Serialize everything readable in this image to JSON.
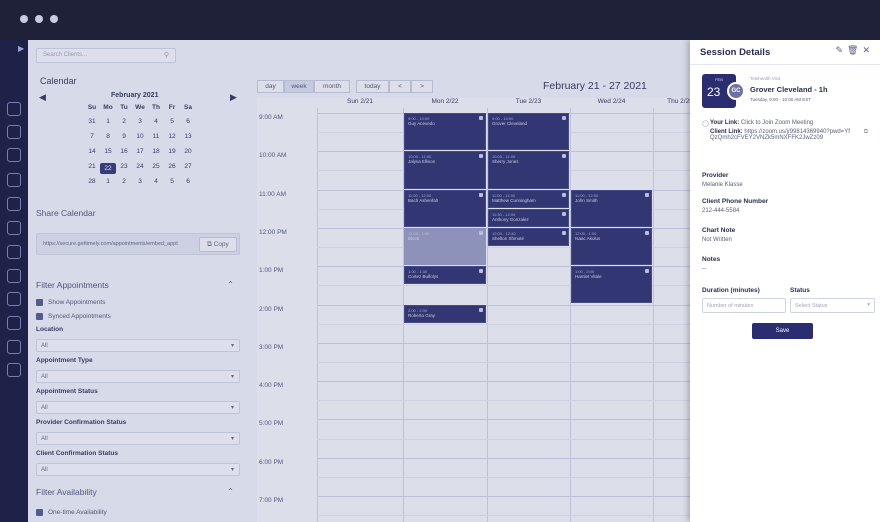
{
  "search": {
    "placeholder": "Search Clients..."
  },
  "calendar_title": "Calendar",
  "mini_calendar": {
    "month": "February 2021",
    "weekdays": [
      "Su",
      "Mo",
      "Tu",
      "We",
      "Th",
      "Fr",
      "Sa"
    ],
    "weeks": [
      [
        "31",
        "1",
        "2",
        "3",
        "4",
        "5",
        "6"
      ],
      [
        "7",
        "8",
        "9",
        "10",
        "11",
        "12",
        "13"
      ],
      [
        "14",
        "15",
        "16",
        "17",
        "18",
        "19",
        "20"
      ],
      [
        "21",
        "22",
        "23",
        "24",
        "25",
        "26",
        "27"
      ],
      [
        "28",
        "1",
        "2",
        "3",
        "4",
        "5",
        "6"
      ]
    ],
    "selected": "22"
  },
  "share": {
    "title": "Share Calendar",
    "url": "https://secure.gettimely.com/appointments/embed_appt",
    "copy_label": "Copy"
  },
  "filter_appointments": {
    "title": "Filter Appointments",
    "checkboxes": [
      "Show Appointments",
      "Synced Appointments"
    ],
    "fields": [
      {
        "label": "Location",
        "value": "All"
      },
      {
        "label": "Appointment Type",
        "value": "All"
      },
      {
        "label": "Appointment Status",
        "value": "All"
      },
      {
        "label": "Provider Confirmation Status",
        "value": "All"
      },
      {
        "label": "Client Confirmation Status",
        "value": "All"
      }
    ]
  },
  "filter_availability": {
    "title": "Filter Availability",
    "checkbox": "One-time Availability"
  },
  "toolbar": {
    "views": [
      "day",
      "week",
      "month"
    ],
    "active_view": "week",
    "today": "today",
    "prev": "<",
    "next": ">",
    "range": "February 21 - 27 2021"
  },
  "week": {
    "days": [
      "Sun 2/21",
      "Mon 2/22",
      "Tue 2/23",
      "Wed 2/24",
      "Thu 2/25"
    ],
    "times": [
      "9:00 AM",
      "10:00 AM",
      "11:00 AM",
      "12:00 PM",
      "1:00 PM",
      "2:00 PM",
      "3:00 PM",
      "4:00 PM",
      "5:00 PM",
      "6:00 PM",
      "7:00 PM"
    ]
  },
  "events": [
    {
      "day": 1,
      "name": "Guy Acevedo",
      "time": "9:00 - 10:00"
    },
    {
      "day": 1,
      "name": "Jalysa Ellison",
      "time": "10:00 - 11:00"
    },
    {
      "day": 1,
      "name": "Bach Ashenfalt",
      "time": "11:00 - 12:00"
    },
    {
      "day": 1,
      "name": "Block",
      "time": "12:00 - 1:00"
    },
    {
      "day": 1,
      "name": "Cortez Bulfolys",
      "time": "1:00 - 1:30"
    },
    {
      "day": 1,
      "name": "Roberto Gray",
      "time": "2:00 - 2:30"
    },
    {
      "day": 2,
      "name": "Grover Cleveland",
      "time": "9:00 - 10:00"
    },
    {
      "day": 2,
      "name": "Sherry Jones",
      "time": "10:00 - 11:00"
    },
    {
      "day": 2,
      "name": "Matthew Cunningham",
      "time": "11:00 - 11:30"
    },
    {
      "day": 2,
      "name": "Anthony Gonzalez",
      "time": "11:30 - 12:00"
    },
    {
      "day": 2,
      "name": "Shelton Shmoté",
      "time": "12:00 - 12:30"
    },
    {
      "day": 3,
      "name": "John Smith",
      "time": "11:00 - 12:00"
    },
    {
      "day": 3,
      "name": "Isaac Akolus",
      "time": "12:00 - 1:00"
    },
    {
      "day": 3,
      "name": "Hamlet Vitale",
      "time": "1:00 - 2:00"
    }
  ],
  "panel": {
    "title": "Session Details",
    "date_month": "FEB",
    "date_day": "23",
    "avatar_initials": "GC",
    "tag": "Telehealth Visit",
    "name": "Grover Cleveland - 1h",
    "when": "Tuesday, 9:00 - 10:00 AM EST",
    "your_link_label": "Your Link:",
    "your_link_value": "Click to Join Zoom Meeting",
    "client_link_label": "Client Link:",
    "client_link_value": "https://zoom.us/j/99814369940?pwd=YfQzQmh2cFVEY2VNZk5mNXFFK2JwZz09",
    "provider_label": "Provider",
    "provider_value": "Melanie Klasse",
    "phone_label": "Client Phone Number",
    "phone_value": "212-444-5584",
    "chart_label": "Chart Note",
    "chart_value": "Not Written",
    "notes_label": "Notes",
    "notes_value": "--",
    "duration_label": "Duration (minutes)",
    "duration_placeholder": "Number of minutes",
    "status_label": "Status",
    "status_placeholder": "Select Status",
    "save_label": "Save"
  },
  "colors": {
    "event": "#232766",
    "accent": "#2a2e70",
    "rail": "#1e2148"
  }
}
